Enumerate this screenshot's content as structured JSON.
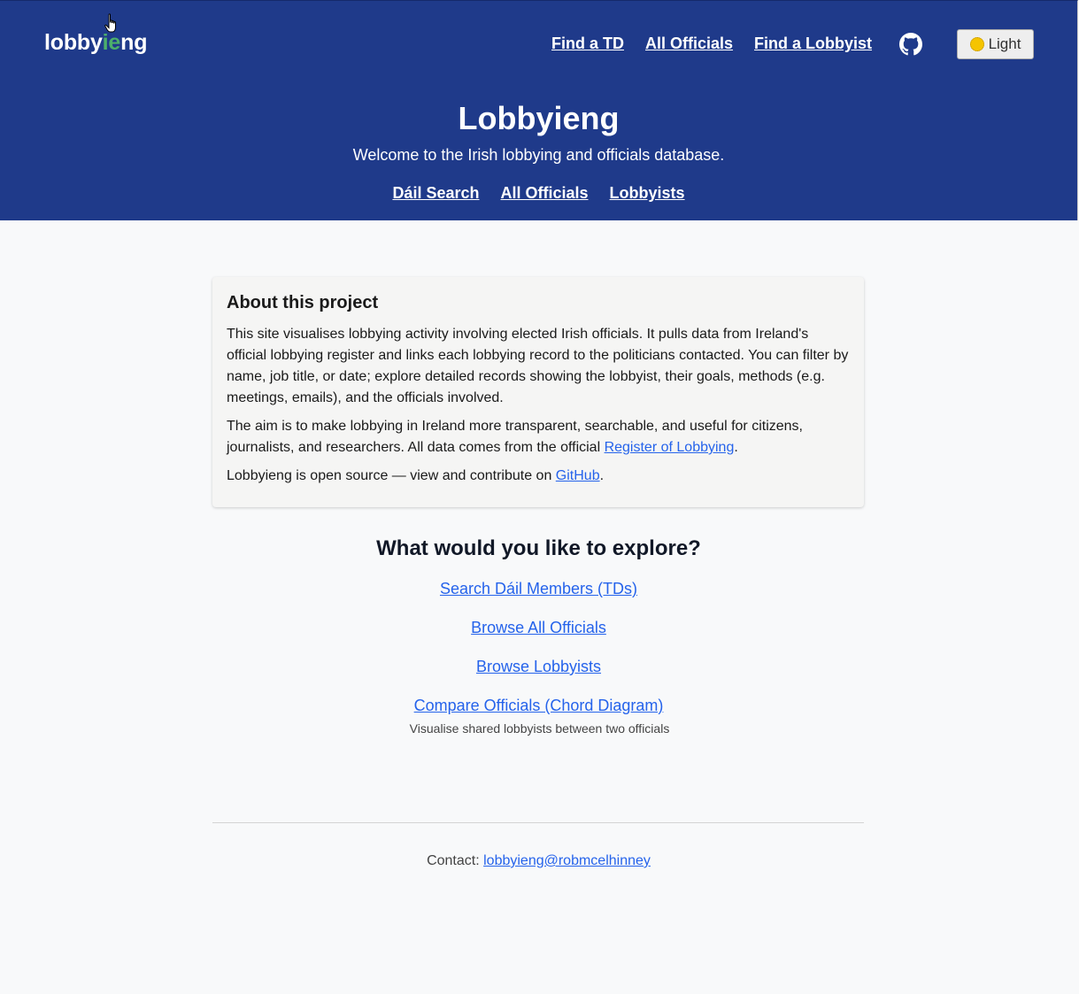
{
  "nav": {
    "logo_part1": "lobby",
    "logo_accent": "ie",
    "logo_part2": "ng",
    "links": [
      "Find a TD",
      "All Officials",
      "Find a Lobbyist"
    ],
    "theme_toggle_label": "Light"
  },
  "hero": {
    "title": "Lobbyieng",
    "subtitle": "Welcome to the Irish lobbying and officials database.",
    "links": [
      "Dáil Search",
      "All Officials",
      "Lobbyists"
    ]
  },
  "about": {
    "heading": "About this project",
    "paragraph1": "This site visualises lobbying activity involving elected Irish officials. It pulls data from Ireland's official lobbying register and links each lobbying record to the politicians contacted. You can filter by name, job title, or date; explore detailed records showing the lobbyist, their goals, methods (e.g. meetings, emails), and the officials involved.",
    "paragraph2_text": "The aim is to make lobbying in Ireland more transparent, searchable, and useful for citizens, journalists, and researchers. All data comes from the official ",
    "paragraph2_link": "Register of Lobbying",
    "paragraph2_end": ".",
    "paragraph3_text": "Lobbyieng is open source — view and contribute on ",
    "paragraph3_link": "GitHub",
    "paragraph3_end": "."
  },
  "explore": {
    "heading": "What would you like to explore?",
    "links": [
      "Search Dáil Members (TDs)",
      "Browse All Officials",
      "Browse Lobbyists",
      "Compare Officials (Chord Diagram)"
    ],
    "chord_note": "Visualise shared lobbyists between two officials"
  },
  "footer": {
    "contact_label": "Contact: ",
    "contact_email": "lobbyieng@robmcelhinney"
  },
  "colors": {
    "header_bg": "#1f3a8a",
    "logo_accent": "#4caf6b",
    "link": "#2563eb",
    "page_bg": "#f8f9fa"
  },
  "icons": {
    "github": "github-icon",
    "theme": "sun-icon",
    "cursor": "hand-cursor-icon"
  }
}
